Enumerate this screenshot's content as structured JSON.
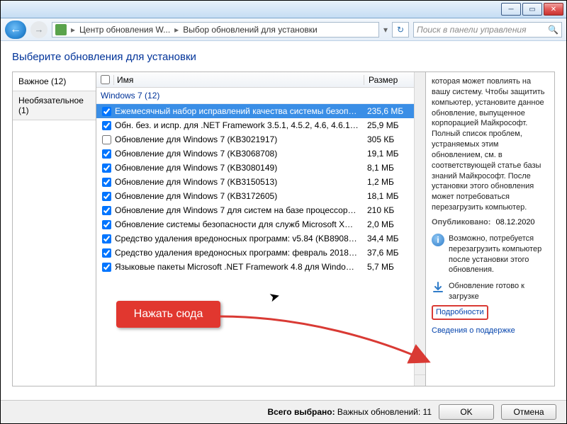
{
  "breadcrumb": {
    "segment1": "Центр обновления W...",
    "segment2": "Выбор обновлений для установки"
  },
  "search": {
    "placeholder": "Поиск в панели управления"
  },
  "page": {
    "title": "Выберите обновления для установки"
  },
  "tabs": {
    "important": "Важное (12)",
    "optional": "Необязательное (1)"
  },
  "list": {
    "headers": {
      "name": "Имя",
      "size": "Размер"
    },
    "group": "Windows 7 (12)",
    "rows": [
      {
        "checked": true,
        "selected": true,
        "name": "Ежемесячный набор исправлений качества системы безопа...",
        "size": "235,6 МБ"
      },
      {
        "checked": true,
        "name": "Обн. без. и испр. для .NET Framework 3.5.1, 4.5.2, 4.6, 4.6.1, 4.6...",
        "size": "25,9 МБ"
      },
      {
        "checked": false,
        "name": "Обновление для Windows 7 (KB3021917)",
        "size": "305 КБ"
      },
      {
        "checked": true,
        "name": "Обновление для Windows 7 (KB3068708)",
        "size": "19,1 МБ"
      },
      {
        "checked": true,
        "name": "Обновление для Windows 7 (KB3080149)",
        "size": "8,1 МБ"
      },
      {
        "checked": true,
        "name": "Обновление для Windows 7 (KB3150513)",
        "size": "1,2 МБ"
      },
      {
        "checked": true,
        "name": "Обновление для Windows 7 (KB3172605)",
        "size": "18,1 МБ"
      },
      {
        "checked": true,
        "name": "Обновление для Windows 7 для систем на базе процессоров...",
        "size": "210 КБ"
      },
      {
        "checked": true,
        "name": "Обновление системы безопасности для служб Microsoft XM...",
        "size": "2,0 МБ"
      },
      {
        "checked": true,
        "name": "Средство удаления вредоносных программ: v5.84 (KB890830)",
        "size": "34,4 МБ"
      },
      {
        "checked": true,
        "name": "Средство удаления вредоносных программ: февраль 2018 г. ...",
        "size": "37,6 МБ"
      },
      {
        "checked": true,
        "name": "Языковые пакеты Microsoft .NET Framework 4.8 для Windows ...",
        "size": "5,7 МБ"
      }
    ]
  },
  "details": {
    "desc": "которая может повлиять на вашу систему. Чтобы защитить компьютер, установите данное обновление, выпущенное корпорацией Майкрософт. Полный список проблем, устраняемых этим обновлением, см. в соответствующей статье базы знаний Майкрософт. После установки этого обновления может потребоваться перезагрузить компьютер.",
    "published_label": "Опубликовано:",
    "published_date": "08.12.2020",
    "restart_notice": "Возможно, потребуется перезагрузить компьютер после установки этого обновления.",
    "download_ready": "Обновление готово к загрузке",
    "details_link": "Подробности",
    "support_link": "Сведения о поддержке"
  },
  "bottom": {
    "status_label": "Всего выбрано:",
    "status_value": "Важных обновлений: 11",
    "ok": "OK",
    "cancel": "Отмена"
  },
  "annotation": {
    "label": "Нажать сюда"
  }
}
